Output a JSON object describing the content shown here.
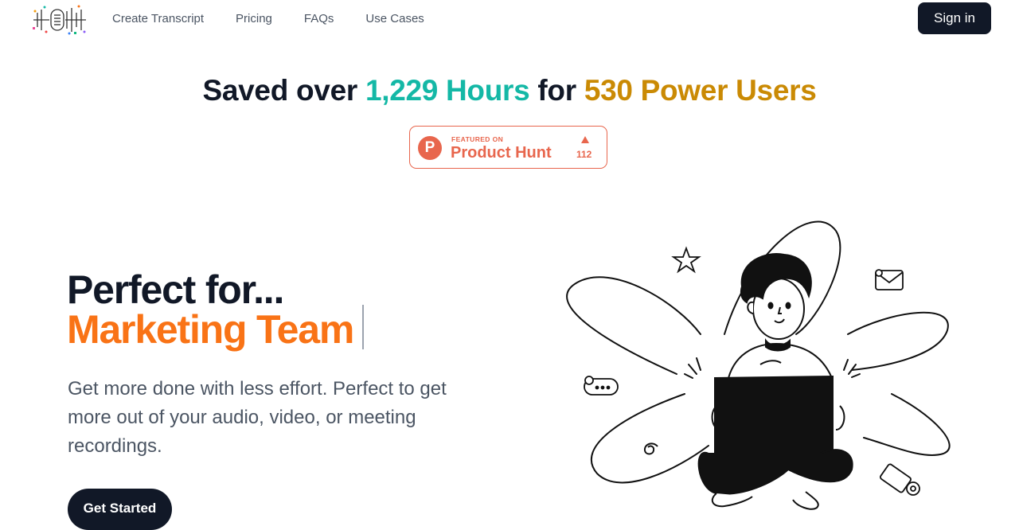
{
  "nav": {
    "logo_icon": "waveform-logo-icon",
    "links": [
      "Create Transcript",
      "Pricing",
      "FAQs",
      "Use Cases"
    ],
    "signin_label": "Sign in"
  },
  "stats": {
    "prefix": "Saved over",
    "hours": "1,229 Hours",
    "middle": "for",
    "users": "530 Power Users"
  },
  "product_hunt": {
    "featured": "FEATURED ON",
    "name": "Product Hunt",
    "logo_letter": "P",
    "upvotes": "112"
  },
  "hero": {
    "line1": "Perfect for...",
    "line2": "Marketing Team",
    "description": "Get more done with less effort. Perfect to get more out of your audio, video, or meeting recordings.",
    "cta_label": "Get Started"
  },
  "illustration": {
    "icons": [
      "star-icon",
      "mail-icon",
      "chat-bubble-icon",
      "spiral-icon",
      "envelope-at-icon"
    ]
  },
  "colors": {
    "teal": "#14b8a6",
    "gold": "#ca8a04",
    "orange": "#f97316",
    "navy": "#111827",
    "product_hunt": "#e8664d"
  }
}
